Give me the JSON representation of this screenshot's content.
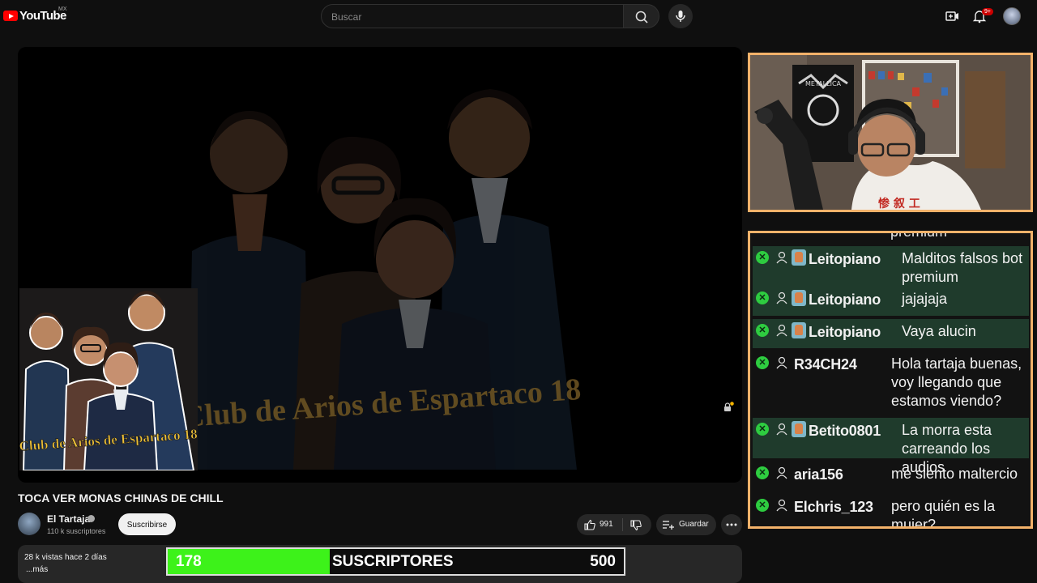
{
  "topbar": {
    "logo_text": "YouTube",
    "country_code": "MX",
    "search_placeholder": "Buscar",
    "notification_count": "9+"
  },
  "video": {
    "overlay_title": "Club de Arios de Espartaco 18",
    "title": "TOCA VER MONAS CHINAS DE CHILL"
  },
  "channel": {
    "name": "El Tartaja",
    "subscribers": "110 k suscriptores",
    "subscribe_label": "Suscribirse"
  },
  "actions": {
    "like_count": "991",
    "save_label": "Guardar"
  },
  "description": {
    "meta": "28 k vistas  hace 2 días",
    "more": "...más"
  },
  "sub_goal": {
    "current": "178",
    "label": "SUSCRIPTORES",
    "target": "500",
    "fill_fraction": 0.356,
    "fill_color": "#3df21a"
  },
  "chat": {
    "clipped_text": "premium",
    "messages": [
      {
        "user": "Leitopiano",
        "badge": true,
        "highlight": true,
        "text": "Malditos falsos bot premium"
      },
      {
        "user": "Leitopiano",
        "badge": true,
        "highlight": true,
        "text": "jajajaja"
      },
      {
        "user": "Leitopiano",
        "badge": true,
        "highlight": true,
        "text": "Vaya alucin"
      },
      {
        "user": "R34CH24",
        "badge": false,
        "highlight": false,
        "text": "Hola tartaja buenas, voy llegando que estamos viendo?"
      },
      {
        "user": "Betito0801",
        "badge": true,
        "highlight": true,
        "text": "La morra esta carreando los audios"
      },
      {
        "user": "aria156",
        "badge": false,
        "highlight": false,
        "text": "me siento maltercio"
      },
      {
        "user": "Elchris_123",
        "badge": false,
        "highlight": false,
        "text": "pero quién es la mujer?"
      }
    ]
  },
  "colors": {
    "accent_frame": "#f3b26a",
    "chat_highlight": "#1f3b2c",
    "mod_badge": "#2ecc40"
  }
}
